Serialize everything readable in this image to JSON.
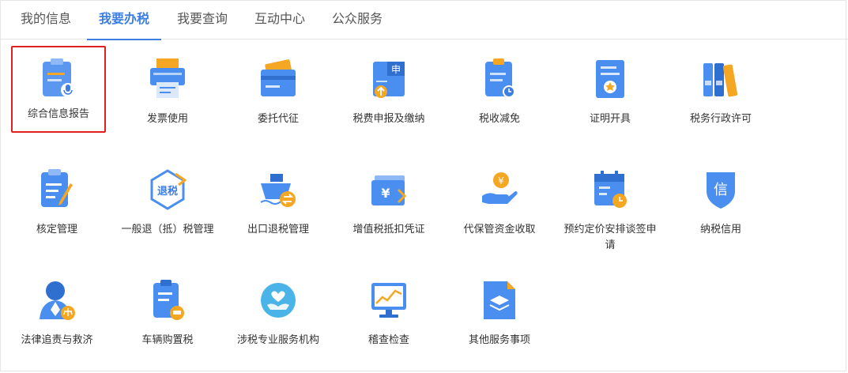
{
  "tabs": [
    {
      "label": "我的信息"
    },
    {
      "label": "我要办税"
    },
    {
      "label": "我要查询"
    },
    {
      "label": "互动中心"
    },
    {
      "label": "公众服务"
    }
  ],
  "services": [
    {
      "label": "综合信息报告",
      "icon": "clipboard-mic-icon"
    },
    {
      "label": "发票使用",
      "icon": "printer-icon"
    },
    {
      "label": "委托代征",
      "icon": "card-wallet-icon"
    },
    {
      "label": "税费申报及缴纳",
      "icon": "declare-upload-icon"
    },
    {
      "label": "税收减免",
      "icon": "clipboard-clock-icon"
    },
    {
      "label": "证明开具",
      "icon": "certificate-icon"
    },
    {
      "label": "税务行政许可",
      "icon": "binders-icon"
    },
    {
      "label": "核定管理",
      "icon": "clipboard-pencil-icon"
    },
    {
      "label": "一般退（抵）税管理",
      "icon": "tax-refund-hexagon-icon"
    },
    {
      "label": "出口退税管理",
      "icon": "ship-exchange-icon"
    },
    {
      "label": "增值税抵扣凭证",
      "icon": "yuan-voucher-icon"
    },
    {
      "label": "代保管资金收取",
      "icon": "hand-coin-icon"
    },
    {
      "label": "预约定价安排谈签申请",
      "icon": "calendar-clock-icon"
    },
    {
      "label": "纳税信用",
      "icon": "credit-shield-icon"
    },
    {
      "label": "法律追责与救济",
      "icon": "judge-scale-icon"
    },
    {
      "label": "车辆购置税",
      "icon": "clipboard-car-icon"
    },
    {
      "label": "涉税专业服务机构",
      "icon": "heart-hand-icon"
    },
    {
      "label": "稽查检查",
      "icon": "monitor-chart-icon"
    },
    {
      "label": "其他服务事项",
      "icon": "document-layers-icon"
    }
  ],
  "text": {
    "refund_badge": "退税",
    "declare_badge": "申",
    "credit_char": "信",
    "yuan": "¥"
  },
  "colors": {
    "accent": "#3d7fe0",
    "icon_blue": "#4a8ef0",
    "icon_orange": "#f5a623",
    "selected_border": "#e02020"
  }
}
